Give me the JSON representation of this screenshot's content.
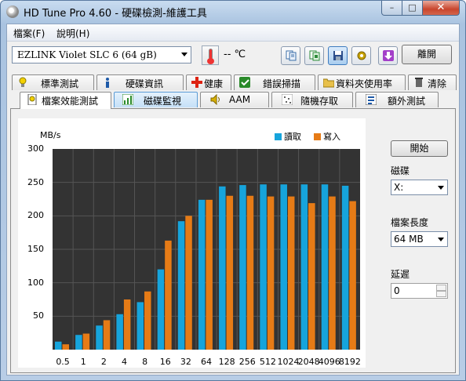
{
  "window": {
    "title": "HD Tune Pro 4.60 - 硬碟檢測-維護工具",
    "min": "–",
    "max": "□",
    "close": "✕"
  },
  "menu": [
    {
      "label": "檔案(F)"
    },
    {
      "label": "說明(H)"
    }
  ],
  "toolbar": {
    "drive": "EZLINK  Violet SLC 6     (64 gB)",
    "temperature": "-- ℃",
    "exit": "離開",
    "icons": [
      "copy-text-icon",
      "copy-screenshot-icon",
      "save-icon",
      "options-icon",
      "download-icon"
    ]
  },
  "tabs_row1": [
    {
      "label": "標準測試",
      "icon": "bulb-icon"
    },
    {
      "label": "硬碟資訊",
      "icon": "info-icon"
    },
    {
      "label": "健康",
      "icon": "health-icon"
    },
    {
      "label": "錯誤掃描",
      "icon": "error-scan-icon"
    },
    {
      "label": "資料夾使用率",
      "icon": "folder-icon"
    },
    {
      "label": "清除",
      "icon": "trash-icon"
    }
  ],
  "tabs_row2": [
    {
      "label": "檔案效能測試",
      "icon": "file-benchmark-icon",
      "selected": true
    },
    {
      "label": "磁碟監視",
      "icon": "disk-monitor-icon"
    },
    {
      "label": "AAM",
      "icon": "speaker-icon"
    },
    {
      "label": "隨機存取",
      "icon": "random-access-icon"
    },
    {
      "label": "額外測試",
      "icon": "extra-tests-icon"
    }
  ],
  "side": {
    "start": "開始",
    "disk_label": "磁碟",
    "disk_value": "X:",
    "file_length_label": "檔案長度",
    "file_length_value": "64 MB",
    "delay_label": "延遲",
    "delay_value": "0"
  },
  "colors": {
    "read": "#16a4dc",
    "write": "#e67b16",
    "plot_bg": "#333333",
    "grid": "#555555"
  },
  "chart_data": {
    "type": "bar",
    "ylabel": "MB/s",
    "ylim": [
      0,
      300
    ],
    "yticks": [
      50,
      100,
      150,
      200,
      250,
      300
    ],
    "categories": [
      "0.5",
      "1",
      "2",
      "4",
      "8",
      "16",
      "32",
      "64",
      "128",
      "256",
      "512",
      "1024",
      "2048",
      "4096",
      "8192"
    ],
    "series": [
      {
        "name": "讀取",
        "values": [
          12,
          22,
          36,
          53,
          71,
          120,
          192,
          224,
          244,
          246,
          247,
          247,
          247,
          247,
          245
        ]
      },
      {
        "name": "寫入",
        "values": [
          8,
          24,
          44,
          75,
          87,
          163,
          200,
          224,
          230,
          230,
          229,
          229,
          219,
          229,
          222
        ]
      }
    ]
  }
}
